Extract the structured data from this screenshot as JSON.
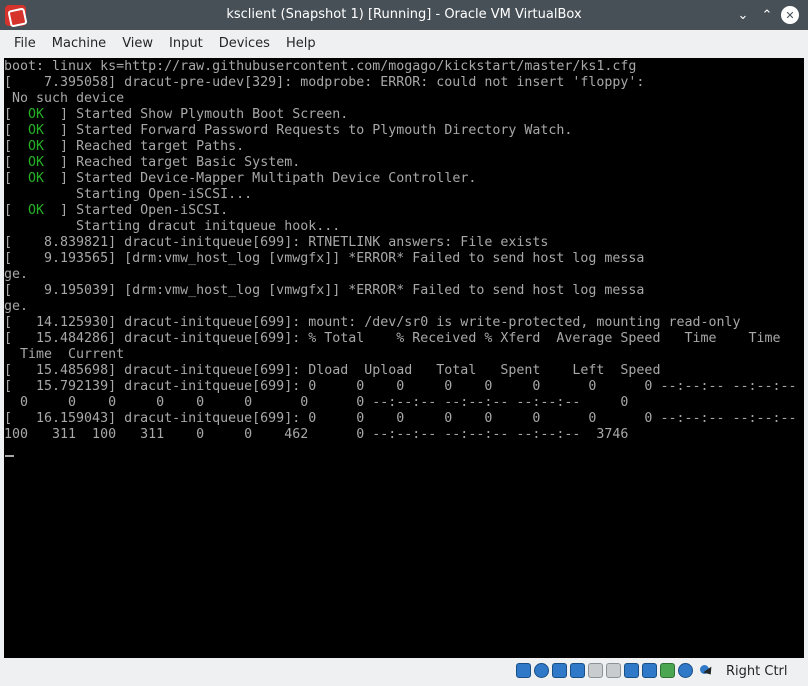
{
  "window": {
    "title": "ksclient (Snapshot 1) [Running] - Oracle VM VirtualBox",
    "minimize_glyph": "⌄",
    "maximize_glyph": "⌃",
    "close_glyph": "✕"
  },
  "menu": {
    "items": [
      "File",
      "Machine",
      "View",
      "Input",
      "Devices",
      "Help"
    ]
  },
  "console": {
    "lines": [
      "boot: linux ks=http://raw.githubusercontent.com/mogago/kickstart/master/ks1.cfg",
      "[    7.395058] dracut-pre-udev[329]: modprobe: ERROR: could not insert 'floppy':",
      " No such device",
      "[  OK  ] Started Show Plymouth Boot Screen.",
      "[  OK  ] Started Forward Password Requests to Plymouth Directory Watch.",
      "[  OK  ] Reached target Paths.",
      "[  OK  ] Reached target Basic System.",
      "[  OK  ] Started Device-Mapper Multipath Device Controller.",
      "         Starting Open-iSCSI...",
      "[  OK  ] Started Open-iSCSI.",
      "         Starting dracut initqueue hook...",
      "[    8.839821] dracut-initqueue[699]: RTNETLINK answers: File exists",
      "[    9.193565] [drm:vmw_host_log [vmwgfx]] *ERROR* Failed to send host log messa",
      "ge.",
      "[    9.195039] [drm:vmw_host_log [vmwgfx]] *ERROR* Failed to send host log messa",
      "ge.",
      "[   14.125930] dracut-initqueue[699]: mount: /dev/sr0 is write-protected, mounting read-only",
      "[   15.484286] dracut-initqueue[699]: % Total    % Received % Xferd  Average Speed   Time    Time",
      "  Time  Current",
      "[   15.485698] dracut-initqueue[699]: Dload  Upload   Total   Spent    Left  Speed",
      "[   15.792139] dracut-initqueue[699]: 0     0    0     0    0     0      0      0 --:--:-- --:--:--",
      "  0     0    0     0    0     0      0      0 --:--:-- --:--:-- --:--:--     0",
      "[   16.159043] dracut-initqueue[699]: 0     0    0     0    0     0      0      0 --:--:-- --:--:--",
      "100   311  100   311    0     0    462      0 --:--:-- --:--:-- --:--:--  3746"
    ],
    "ok_label": "OK"
  },
  "statusbar": {
    "icons": [
      "hard-disk-icon",
      "optical-drive-icon",
      "audio-icon",
      "network-icon",
      "usb-icon",
      "shared-folders-icon",
      "display-icon",
      "recording-icon",
      "virtualization-icon",
      "mouse-integration-icon"
    ],
    "host_key": "Right Ctrl"
  },
  "colors": {
    "titlebar": "#475057",
    "console_bg": "#000000",
    "console_text": "#a8a8a8",
    "ok_green": "#26b226"
  }
}
